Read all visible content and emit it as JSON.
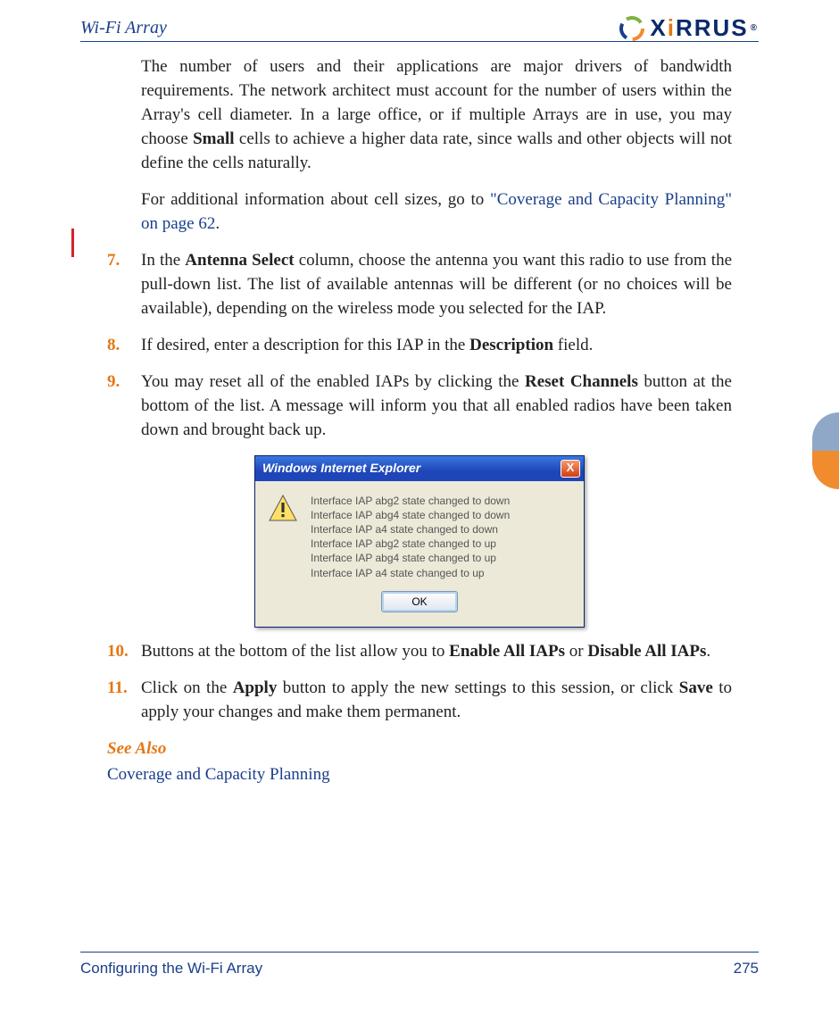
{
  "header": {
    "title": "Wi-Fi Array",
    "logo_text_pre": "X",
    "logo_text_i": "i",
    "logo_text_post": "RRUS"
  },
  "intro": {
    "p1_a": "The number of users and their applications are major drivers of bandwidth requirements. The network architect must account for the number of users within the Array's cell diameter. In a large office, or if multiple Arrays are in use, you may choose ",
    "p1_bold": "Small",
    "p1_b": " cells to achieve a higher data rate, since walls and other objects will not define the cells naturally.",
    "p2_a": "For additional information about cell sizes, go to ",
    "p2_link": "\"Coverage and Capacity Planning\" on page 62",
    "p2_b": "."
  },
  "items": {
    "n7": "7.",
    "t7_a": "In the ",
    "t7_bold": "Antenna Select",
    "t7_b": " column, choose the antenna you want this radio to use from the pull-down list. The list of available antennas will be different (or no choices will be available), depending on the wireless mode you selected for the IAP.",
    "n8": "8.",
    "t8_a": "If desired, enter a description for this IAP in the ",
    "t8_bold": "Description",
    "t8_b": " field.",
    "n9": "9.",
    "t9_a": "You may reset all of the enabled IAPs by clicking the ",
    "t9_bold": "Reset Channels",
    "t9_b": " button at the bottom of the list. A message will inform you that all enabled radios have been taken down and brought back up.",
    "n10": "10.",
    "t10_a": "Buttons at the bottom of the list allow you to ",
    "t10_bold1": "Enable All IAPs",
    "t10_mid": " or ",
    "t10_bold2": "Disable All IAPs",
    "t10_b": ".",
    "n11": "11.",
    "t11_a": "Click on the ",
    "t11_bold1": "Apply",
    "t11_mid": " button to apply the new settings to this session, or click ",
    "t11_bold2": "Save",
    "t11_b": " to apply your changes and make them permanent."
  },
  "dialog": {
    "title": "Windows Internet Explorer",
    "lines": {
      "l1": "Interface IAP abg2 state changed to down",
      "l2": "Interface IAP abg4 state changed to down",
      "l3": "Interface IAP a4 state changed to down",
      "l4": "Interface IAP abg2 state changed to up",
      "l5": "Interface IAP abg4 state changed to up",
      "l6": "Interface IAP a4 state changed to up"
    },
    "ok": "OK",
    "close": "X"
  },
  "see_also": {
    "heading": "See Also",
    "link1": "Coverage and Capacity Planning"
  },
  "footer": {
    "left": "Configuring the Wi-Fi Array",
    "right": "275"
  }
}
